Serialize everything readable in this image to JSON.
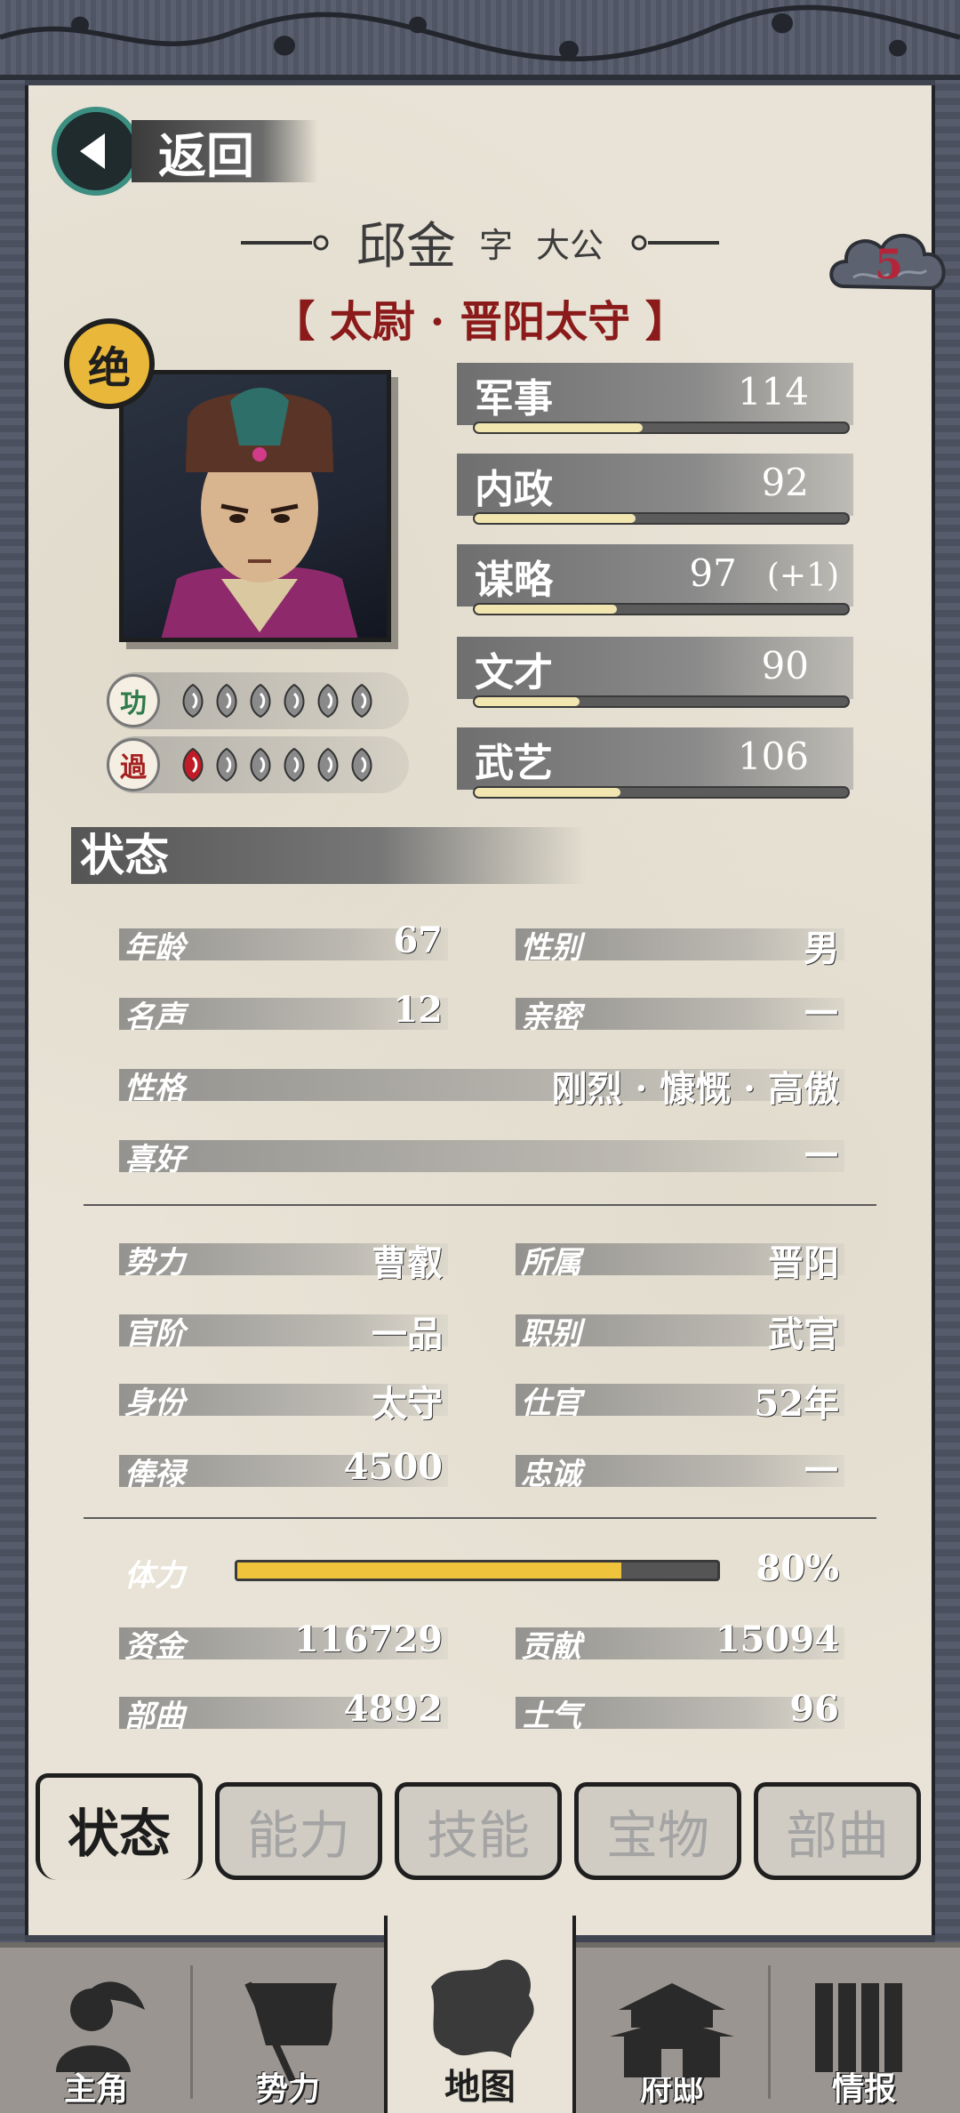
{
  "header": {
    "back_label": "返回",
    "name": "邱金",
    "courtesy_prefix": "字",
    "courtesy_name": "大公",
    "titles": "【 太尉 · 晋阳太守 】",
    "badge_number": "5",
    "grade_badge": "绝"
  },
  "merit": {
    "gong_label": "功",
    "guo_label": "過",
    "gong_count": 6,
    "guo_filled": 1,
    "guo_total": 6
  },
  "attributes": [
    {
      "label": "军事",
      "value": "114",
      "bonus": "",
      "fill": 0.45
    },
    {
      "label": "内政",
      "value": "92",
      "bonus": "",
      "fill": 0.43
    },
    {
      "label": "谋略",
      "value": "97",
      "bonus": "(+1)",
      "fill": 0.38
    },
    {
      "label": "文才",
      "value": "90",
      "bonus": "",
      "fill": 0.28
    },
    {
      "label": "武艺",
      "value": "106",
      "bonus": "",
      "fill": 0.39
    }
  ],
  "status": {
    "header": "状态",
    "age_label": "年龄",
    "age": "67",
    "gender_label": "性别",
    "gender": "男",
    "fame_label": "名声",
    "fame": "12",
    "intimacy_label": "亲密",
    "intimacy": "—",
    "personality_label": "性格",
    "personality": "刚烈 · 慷慨 · 高傲",
    "hobby_label": "喜好",
    "hobby": "—",
    "faction_label": "势力",
    "faction": "曹叡",
    "belong_label": "所属",
    "belong": "晋阳",
    "rank_label": "官阶",
    "rank": "一品",
    "duty_label": "职别",
    "duty": "武官",
    "identity_label": "身份",
    "identity": "太守",
    "service_label": "仕官",
    "service": "52年",
    "salary_label": "俸禄",
    "salary": "4500",
    "loyalty_label": "忠诚",
    "loyalty": "—",
    "stamina_label": "体力",
    "stamina": "80%",
    "stamina_fill": 0.8,
    "funds_label": "资金",
    "funds": "116729",
    "contribution_label": "贡献",
    "contribution": "15094",
    "troops_label": "部曲",
    "troops": "4892",
    "morale_label": "士气",
    "morale": "96"
  },
  "tabs": [
    "状态",
    "能力",
    "技能",
    "宝物",
    "部曲"
  ],
  "nav": [
    "主角",
    "势力",
    "地图",
    "府邸",
    "情报"
  ],
  "colors": {
    "accent_red": "#8b1a1a",
    "gold": "#e9b83a",
    "stamina": "#f0c33c"
  }
}
